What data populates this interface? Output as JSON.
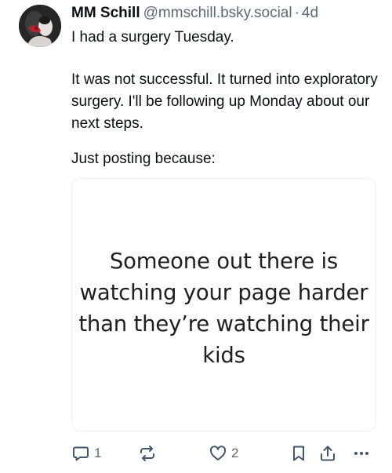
{
  "author": {
    "display_name": "MM Schill",
    "handle": "@mmschill.bsky.social",
    "separator": "·",
    "time": "4d"
  },
  "post": {
    "paragraphs": [
      "I had a surgery Tuesday.",
      "It was not successful. It turned into exploratory surgery. I'll be following up Monday about our next steps.",
      "Just posting because:"
    ]
  },
  "embed": {
    "lines": [
      "Someone out there is",
      "watching your page harder",
      "than they’re watching their",
      "kids"
    ]
  },
  "actions": {
    "reply": {
      "icon": "reply-icon",
      "count": "1"
    },
    "repost": {
      "icon": "repost-icon",
      "count": ""
    },
    "like": {
      "icon": "heart-icon",
      "count": "2"
    },
    "bookmark": {
      "icon": "bookmark-icon"
    },
    "share": {
      "icon": "share-icon"
    },
    "more": {
      "icon": "more-icon"
    }
  },
  "colors": {
    "text": "#0b0f14",
    "muted": "#5b6876",
    "icon": "#42576c",
    "border": "#eef0f3"
  }
}
